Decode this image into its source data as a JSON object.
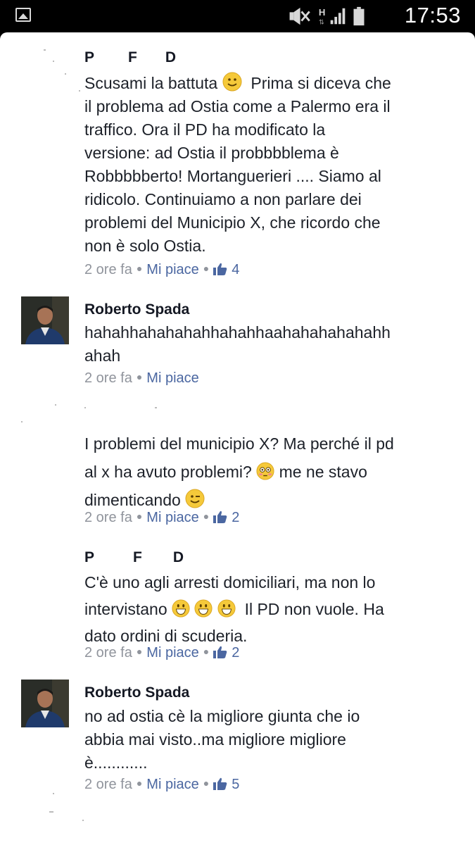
{
  "status_bar": {
    "time": "17:53",
    "network": "H"
  },
  "comments": [
    {
      "author_initials": [
        "P",
        "F",
        "D"
      ],
      "text_lines": [
        "Scusami la battuta",
        "Prima si diceva che",
        "il problema ad Ostia come a Palermo era il",
        "traffico. Ora il PD ha modificato la",
        "versione: ad Ostia il probbbblema è",
        "Robbbbberto! Mortanguerieri .... Siamo al",
        "ridicolo. Continuiamo a non parlare dei",
        "problemi del Municipio X, che ricordo che",
        "non è solo Ostia."
      ],
      "time": "2 ore fa",
      "like_label": "Mi piace",
      "likes": "4"
    },
    {
      "author": "Roberto Spada",
      "text_lines": [
        "hahahhahahahahhahahhaahahahahahahh",
        "ahah"
      ],
      "time": "2 ore fa",
      "like_label": "Mi piace"
    },
    {
      "text_lines": [
        "I problemi del municipio X? Ma perché il pd",
        "al x ha avuto problemi?",
        "me ne stavo",
        "dimenticando"
      ],
      "time": "2 ore fa",
      "like_label": "Mi piace",
      "likes": "2"
    },
    {
      "author_initials": [
        "P",
        "F",
        "D"
      ],
      "text_lines": [
        "C'è uno agli arresti domiciliari, ma non lo",
        "intervistano",
        "Il PD non vuole. Ha",
        "dato ordini di scuderia."
      ],
      "time": "2 ore fa",
      "like_label": "Mi piace",
      "likes": "2"
    },
    {
      "author": "Roberto Spada",
      "text_lines": [
        "no ad ostia cè la migliore giunta che io",
        "abbia mai visto..ma migliore migliore",
        "è............"
      ],
      "time": "2 ore fa",
      "like_label": "Mi piace",
      "likes": "5"
    }
  ]
}
